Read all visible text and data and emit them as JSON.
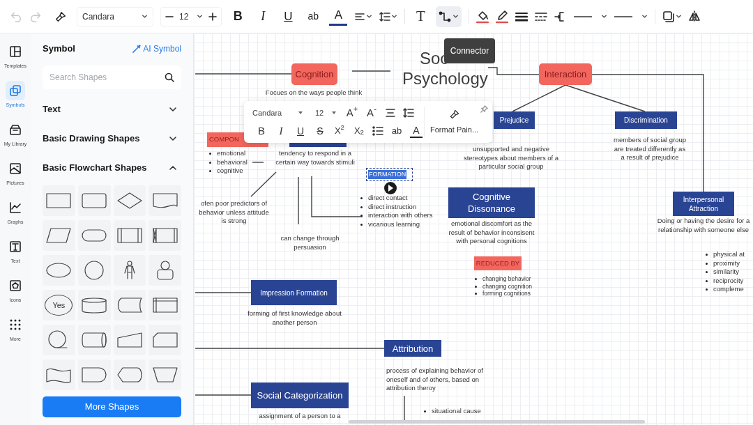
{
  "toolbar": {
    "undo": {
      "disabled": true
    },
    "redo": {
      "disabled": true
    },
    "font": "Candara",
    "font_size": "12",
    "connector_active": true,
    "text_buttons": [
      {
        "kind": "bold",
        "label": "B"
      },
      {
        "kind": "italic",
        "label": "I"
      },
      {
        "kind": "underline",
        "label": "U"
      },
      {
        "kind": "plain",
        "label": "ab"
      },
      {
        "kind": "color",
        "label": "A"
      }
    ],
    "text_tool": "T"
  },
  "rail": [
    {
      "label": "Templates",
      "selected": false
    },
    {
      "label": "Symbols",
      "selected": true
    },
    {
      "label": "My Library",
      "selected": false
    },
    {
      "label": "Pictures",
      "selected": false
    },
    {
      "label": "Graphs",
      "selected": false
    },
    {
      "label": "Text",
      "selected": false
    },
    {
      "label": "Icons",
      "selected": false
    },
    {
      "label": "More",
      "selected": false
    }
  ],
  "panel": {
    "title": "Symbol",
    "ai_button": "AI Symbol",
    "search": {
      "placeholder": "Search Shapes"
    },
    "sections": [
      {
        "label": "Text",
        "expanded": false
      },
      {
        "label": "Basic Drawing Shapes",
        "expanded": false
      },
      {
        "label": "Basic Flowchart Shapes",
        "expanded": true
      }
    ],
    "shape_text": "Yes",
    "more_button": "More Shapes"
  },
  "canvas": {
    "title_lines": [
      "Soc",
      "Psychology"
    ],
    "tooltip": "Connector",
    "nodes": [
      {
        "kind": "red",
        "text": "Cognition"
      },
      {
        "kind": "red",
        "text": "Interaction"
      },
      {
        "kind": "red-small",
        "text": "COMPON"
      },
      {
        "kind": "blue",
        "text": "Prejudice"
      },
      {
        "kind": "blue",
        "text": "Discrimination"
      },
      {
        "kind": "blue-large",
        "text": "Cognitive Dissonance"
      },
      {
        "kind": "red-small",
        "text": "REDUCED BY"
      },
      {
        "kind": "blue",
        "text": "Interpersonal Attraction"
      },
      {
        "kind": "blue",
        "text": "Impression Formation"
      },
      {
        "kind": "blue-large",
        "text": "Attribution"
      },
      {
        "kind": "blue-large",
        "text": "Social Categorization"
      },
      {
        "kind": "blue"
      }
    ],
    "selected_label": {
      "text": "FORMATION",
      "selected": true
    },
    "notes": [
      {
        "kind": "paragraph",
        "text": "Focues on the ways people think"
      },
      {
        "kind": "list",
        "items": [
          "emotional",
          "behavioral",
          "cognitive"
        ]
      },
      {
        "kind": "paragraph",
        "text": "tendency to respond in a certain way towards stimuli"
      },
      {
        "kind": "paragraph",
        "text": "unsupported and negative stereotypes about members of a particular social group"
      },
      {
        "kind": "paragraph",
        "text": "members of social group are treated differently as a result of prejudice"
      },
      {
        "kind": "paragraph",
        "text": "ofen poor predictors of behavior unless attitude is strong"
      },
      {
        "kind": "list",
        "items": [
          "direct contact",
          "direct instruction",
          "interaction with others",
          "vicarious learning"
        ]
      },
      {
        "kind": "paragraph",
        "text": "can change through persuasion"
      },
      {
        "kind": "paragraph",
        "text": "emotional discomfort as the result of behavior inconsisent with personal cognitions"
      },
      {
        "kind": "paragraph",
        "text": "Doing or having the desire for a relationship with someone else"
      },
      {
        "kind": "list",
        "items": [
          "changing behavior",
          "changing cognition",
          "forming cognitions"
        ]
      },
      {
        "kind": "list",
        "items": [
          "physical at",
          "proximity",
          "similarity",
          "reciprocity",
          "compleme"
        ]
      },
      {
        "kind": "paragraph",
        "text": "forming of first knowledge about another person"
      },
      {
        "kind": "paragraph",
        "text": "process of explaining behavior of oneself and of others, based on attribution theroy"
      },
      {
        "kind": "list",
        "items": [
          "situational cause"
        ]
      },
      {
        "kind": "paragraph",
        "text": "assignment of a person to a"
      }
    ]
  },
  "floating_toolbar": {
    "font": "Candara",
    "font_size": "12",
    "row_1": [
      {
        "kind": "grow",
        "label": "A$^{+}$"
      },
      {
        "kind": "shrink",
        "label": "A$^{-}$"
      },
      {
        "kind": "align"
      },
      {
        "kind": "spacing"
      }
    ],
    "row_2": [
      {
        "kind": "bold",
        "label": "B"
      },
      {
        "kind": "italic",
        "label": "I"
      },
      {
        "kind": "underline",
        "label": "U"
      },
      {
        "kind": "strike",
        "label": "S"
      },
      {
        "kind": "superscript",
        "label": "X$^{2}$"
      },
      {
        "kind": "subscript",
        "label": "X$_{2}$"
      },
      {
        "kind": "list"
      },
      {
        "kind": "plain",
        "label": "ab"
      },
      {
        "kind": "color",
        "label": "A"
      }
    ],
    "painter_label": "Format Pain..."
  }
}
